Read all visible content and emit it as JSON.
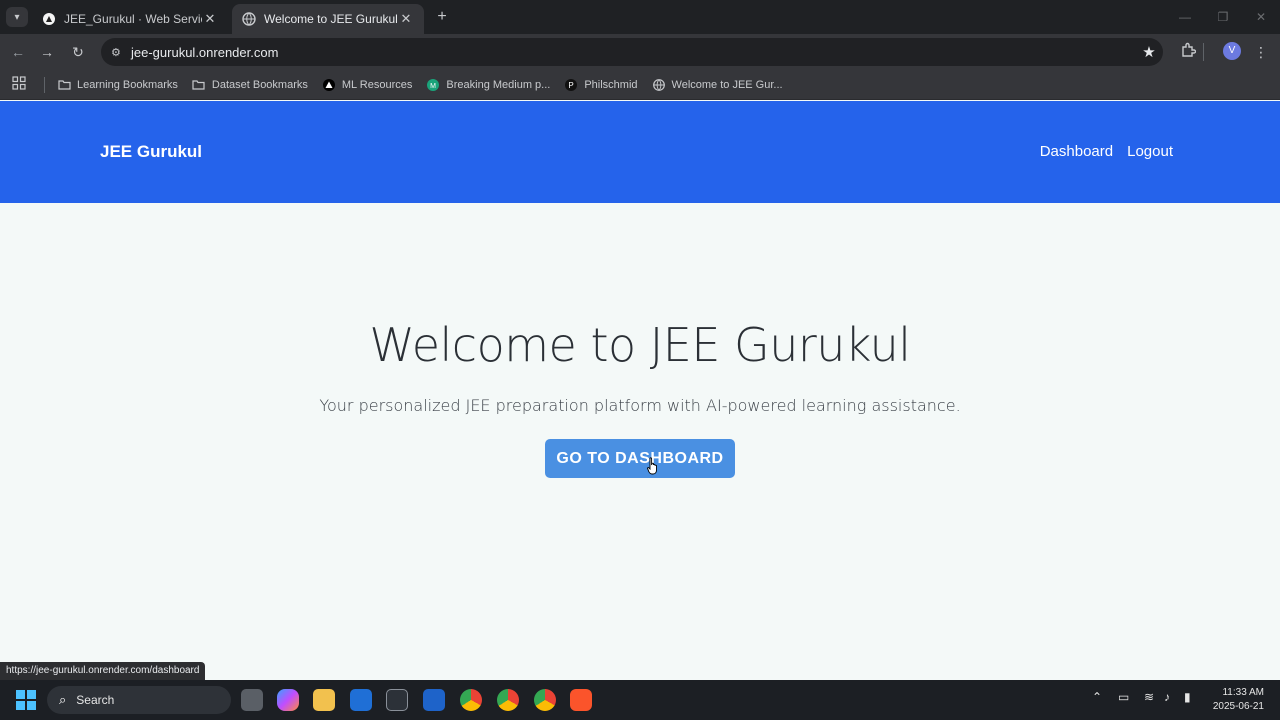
{
  "browser": {
    "tabs": [
      {
        "title": "JEE_Gurukul · Web Service · Re",
        "active": false
      },
      {
        "title": "Welcome to JEE Gurukul",
        "active": true
      }
    ],
    "url": "jee-gurukul.onrender.com",
    "bookmarks": [
      {
        "label": "Learning Bookmarks",
        "icon": "folder-icon"
      },
      {
        "label": "Dataset Bookmarks",
        "icon": "folder-icon"
      },
      {
        "label": "ML Resources",
        "icon": "triangle-icon"
      },
      {
        "label": "Breaking Medium p...",
        "icon": "medium-icon"
      },
      {
        "label": "Philschmid",
        "icon": "p-icon"
      },
      {
        "label": "Welcome to JEE Gur...",
        "icon": "globe-icon"
      }
    ],
    "profile_initial": "V",
    "status_url": "https://jee-gurukul.onrender.com/dashboard"
  },
  "site": {
    "brand": "JEE Gurukul",
    "nav": {
      "dashboard": "Dashboard",
      "logout": "Logout"
    },
    "hero": {
      "title": "Welcome to JEE Gurukul",
      "subtitle": "Your personalized JEE preparation platform with AI-powered learning assistance.",
      "cta": "GO TO DASHBOARD"
    },
    "colors": {
      "header": "#2563eb",
      "cta": "#4a90e2",
      "page_bg": "#f4f9f8"
    }
  },
  "taskbar": {
    "search_placeholder": "Search",
    "time": "11:33 AM",
    "date": "2025-06-21"
  }
}
